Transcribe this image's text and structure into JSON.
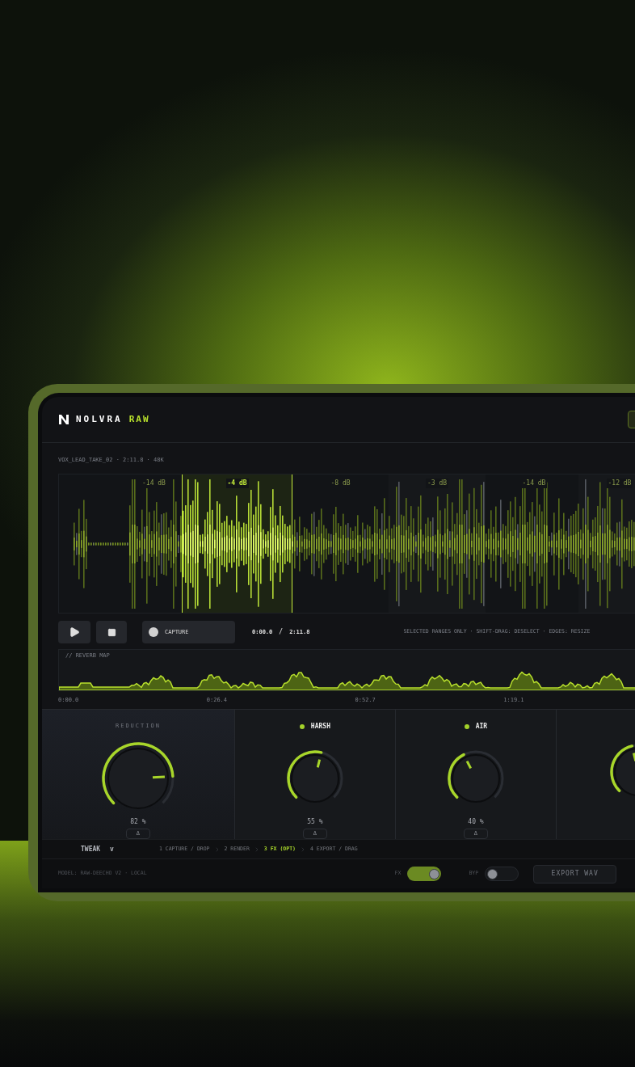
{
  "app": {
    "logo": "NOLVRA",
    "logo_accent": "RAW"
  },
  "file_info": "VOX_LEAD_TAKE_02 · 2:11.8 · 48K",
  "waveform": {
    "segments": [
      {
        "label": "-14 dB",
        "selected": false
      },
      {
        "label": "-4 dB",
        "selected": true
      },
      {
        "label": "-8 dB",
        "selected": false
      },
      {
        "label": "-3 dB",
        "selected": false
      },
      {
        "label": "-14 dB",
        "selected": false
      },
      {
        "label": "-12 dB",
        "selected": false
      }
    ]
  },
  "transport": {
    "capture_label": "CAPTURE",
    "position": "0:00.0",
    "separator": "/",
    "duration": "2:11.8",
    "hint": "SELECTED RANGES ONLY · SHIFT-DRAG: DESELECT · EDGES: RESIZE"
  },
  "reverb_map": {
    "title": "// REVERB MAP",
    "time_ticks": [
      "0:00.0",
      "0:26.4",
      "0:52.7",
      "1:19.1"
    ]
  },
  "knobs": [
    {
      "kind": "main",
      "label": "REDUCTION",
      "reading": "82 %",
      "delta": "Δ"
    },
    {
      "kind": "band",
      "label": "HARSH",
      "color": "#a3d12a",
      "reading": "55 %",
      "delta": "Δ"
    },
    {
      "kind": "band",
      "label": "AIR",
      "color": "#a3d12a",
      "reading": "40 %",
      "delta": "Δ"
    },
    {
      "kind": "partial"
    }
  ],
  "tweak": {
    "label": "TWEAK",
    "caret": "v"
  },
  "steps": [
    {
      "label": "1 CAPTURE / DROP",
      "selected": false
    },
    {
      "label": "2 RENDER",
      "selected": false
    },
    {
      "label": "3 FX (OPT)",
      "selected": true
    },
    {
      "label": "4 EXPORT / DRAG",
      "selected": false
    }
  ],
  "footer": {
    "model": "MODEL: RAW-DEECHO V2 · LOCAL",
    "toggles": [
      {
        "label": "FX",
        "on": true
      },
      {
        "label": "BYP",
        "on": false
      }
    ],
    "export": "EXPORT WAV"
  }
}
